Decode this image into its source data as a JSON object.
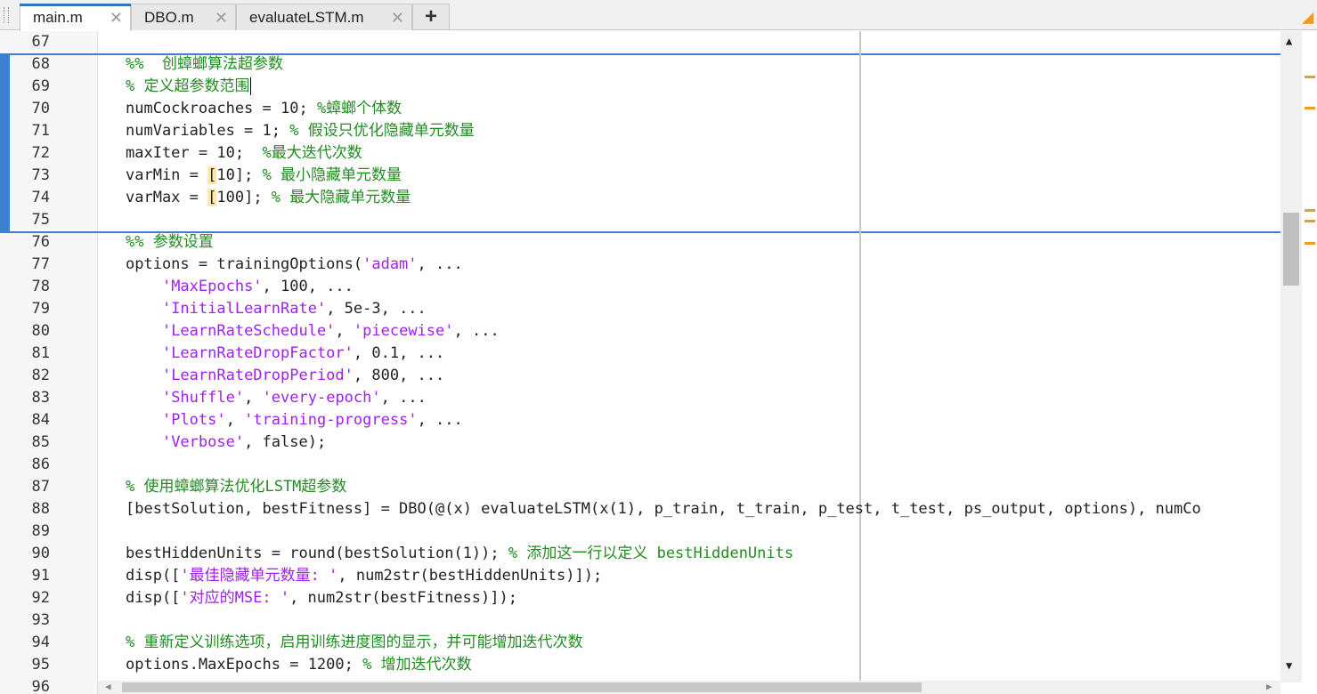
{
  "tabs": [
    {
      "label": "main.m",
      "active": true
    },
    {
      "label": "DBO.m",
      "active": false
    },
    {
      "label": "evaluateLSTM.m",
      "active": false
    }
  ],
  "add_tab_label": "+",
  "close_glyph": "✕",
  "colors": {
    "string": "#a020f0",
    "comment": "#228b22",
    "section_bar": "#3f7fd0",
    "bracket_highlight": "#fde9a8",
    "warning_mark": "#f09a2a"
  },
  "icons": [
    "warning-icon",
    "close-icon",
    "plus-icon",
    "scroll-up-icon",
    "scroll-down-icon",
    "scroll-left-icon",
    "scroll-right-icon"
  ],
  "lines": [
    {
      "n": "67",
      "t": []
    },
    {
      "n": "68",
      "t": [
        [
          "c",
          "%%  创蟑螂算法超参数"
        ]
      ]
    },
    {
      "n": "69",
      "t": [
        [
          "c",
          "% 定义超参数范围"
        ],
        [
          "caret",
          ""
        ]
      ]
    },
    {
      "n": "70",
      "t": [
        [
          "",
          "numCockroaches = 10; "
        ],
        [
          "c",
          "%蟑螂个体数"
        ]
      ]
    },
    {
      "n": "71",
      "t": [
        [
          "",
          "numVariables = 1; "
        ],
        [
          "c",
          "% 假设只优化隐藏单元数量"
        ]
      ]
    },
    {
      "n": "72",
      "t": [
        [
          "",
          "maxIter = 10;  "
        ],
        [
          "c",
          "%最大迭代次数"
        ]
      ]
    },
    {
      "n": "73",
      "t": [
        [
          "",
          "varMin = "
        ],
        [
          "b",
          "["
        ],
        [
          "",
          "10]; "
        ],
        [
          "c",
          "% 最小隐藏单元数量"
        ]
      ]
    },
    {
      "n": "74",
      "t": [
        [
          "",
          "varMax = "
        ],
        [
          "b",
          "["
        ],
        [
          "",
          "100]; "
        ],
        [
          "c",
          "% 最大隐藏单元数量"
        ]
      ]
    },
    {
      "n": "75",
      "t": []
    },
    {
      "n": "76",
      "t": [
        [
          "c",
          "%% 参数设置"
        ]
      ]
    },
    {
      "n": "77",
      "t": [
        [
          "",
          "options = trainingOptions("
        ],
        [
          "s",
          "'adam'"
        ],
        [
          "",
          ", ..."
        ]
      ]
    },
    {
      "n": "78",
      "t": [
        [
          "",
          "    "
        ],
        [
          "s",
          "'MaxEpochs'"
        ],
        [
          "",
          ", 100, ..."
        ]
      ]
    },
    {
      "n": "79",
      "t": [
        [
          "",
          "    "
        ],
        [
          "s",
          "'InitialLearnRate'"
        ],
        [
          "",
          ", 5e-3, ..."
        ]
      ]
    },
    {
      "n": "80",
      "t": [
        [
          "",
          "    "
        ],
        [
          "s",
          "'LearnRateSchedule'"
        ],
        [
          "",
          ", "
        ],
        [
          "s",
          "'piecewise'"
        ],
        [
          "",
          ", ..."
        ]
      ]
    },
    {
      "n": "81",
      "t": [
        [
          "",
          "    "
        ],
        [
          "s",
          "'LearnRateDropFactor'"
        ],
        [
          "",
          ", 0.1, ..."
        ]
      ]
    },
    {
      "n": "82",
      "t": [
        [
          "",
          "    "
        ],
        [
          "s",
          "'LearnRateDropPeriod'"
        ],
        [
          "",
          ", 800, ..."
        ]
      ]
    },
    {
      "n": "83",
      "t": [
        [
          "",
          "    "
        ],
        [
          "s",
          "'Shuffle'"
        ],
        [
          "",
          ", "
        ],
        [
          "s",
          "'every-epoch'"
        ],
        [
          "",
          ", ..."
        ]
      ]
    },
    {
      "n": "84",
      "t": [
        [
          "",
          "    "
        ],
        [
          "s",
          "'Plots'"
        ],
        [
          "",
          ", "
        ],
        [
          "s",
          "'training-progress'"
        ],
        [
          "",
          ", ..."
        ]
      ]
    },
    {
      "n": "85",
      "t": [
        [
          "",
          "    "
        ],
        [
          "s",
          "'Verbose'"
        ],
        [
          "",
          ", false);"
        ]
      ]
    },
    {
      "n": "86",
      "t": []
    },
    {
      "n": "87",
      "t": [
        [
          "c",
          "% 使用蟑螂算法优化LSTM超参数"
        ]
      ]
    },
    {
      "n": "88",
      "t": [
        [
          "",
          "[bestSolution, bestFitness] = DBO(@(x) evaluateLSTM(x(1), p_train, t_train, p_test, t_test, ps_output, options), numCo"
        ]
      ]
    },
    {
      "n": "89",
      "t": []
    },
    {
      "n": "90",
      "t": [
        [
          "",
          "bestHiddenUnits = round(bestSolution(1)); "
        ],
        [
          "c",
          "% 添加这一行以定义 bestHiddenUnits"
        ]
      ]
    },
    {
      "n": "91",
      "t": [
        [
          "",
          "disp(["
        ],
        [
          "s",
          "'最佳隐藏单元数量: '"
        ],
        [
          "",
          ", num2str(bestHiddenUnits)]);"
        ]
      ]
    },
    {
      "n": "92",
      "t": [
        [
          "",
          "disp(["
        ],
        [
          "s",
          "'对应的MSE: '"
        ],
        [
          "",
          ", num2str(bestFitness)]);"
        ]
      ]
    },
    {
      "n": "93",
      "t": []
    },
    {
      "n": "94",
      "t": [
        [
          "c",
          "% 重新定义训练选项，启用训练进度图的显示，并可能增加迭代次数"
        ]
      ]
    },
    {
      "n": "95",
      "t": [
        [
          "",
          "options.MaxEpochs = 1200; "
        ],
        [
          "c",
          "% 增加迭代次数"
        ]
      ]
    },
    {
      "n": "96",
      "t": []
    }
  ]
}
